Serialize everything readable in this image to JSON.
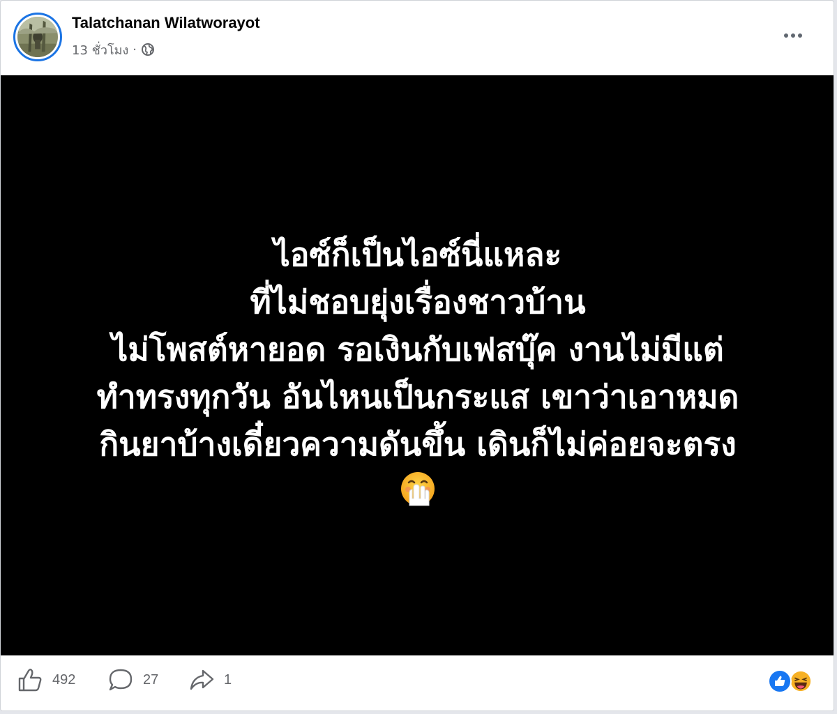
{
  "post": {
    "author": "Talatchanan Wilatworayot",
    "time_ago": "13 ชั่วโมง",
    "separator": "·",
    "audience_icon": "globe-icon",
    "menu_icon": "more-options-icon",
    "text_lines": [
      "ไอซ์ก็เป็นไอซ์นี่แหละ",
      "ที่ไม่ชอบยุ่งเรื่องชาวบ้าน",
      "ไม่โพสต์หายอด รอเงินกับเฟสบุ๊ค งานไม่มีแต่",
      "ทำทรงทุกวัน อันไหนเป็นกระแส เขาว่าเอาหมด",
      "กินยาบ้างเดี๋ยวความดันขึ้น เดินก็ไม่ค่อยจะตรง"
    ],
    "emoji": "face-with-hand-over-mouth-emoji",
    "background_color": "#000000",
    "text_color": "#ffffff"
  },
  "footer": {
    "likes_count": "492",
    "comments_count": "27",
    "shares_count": "1",
    "like_icon": "thumbs-up-icon",
    "comment_icon": "comment-icon",
    "share_icon": "share-icon",
    "reactions": [
      "like-reaction-icon",
      "haha-reaction-icon"
    ]
  },
  "colors": {
    "accent": "#1877f2",
    "secondary_text": "#65676b",
    "primary_text": "#050505"
  }
}
